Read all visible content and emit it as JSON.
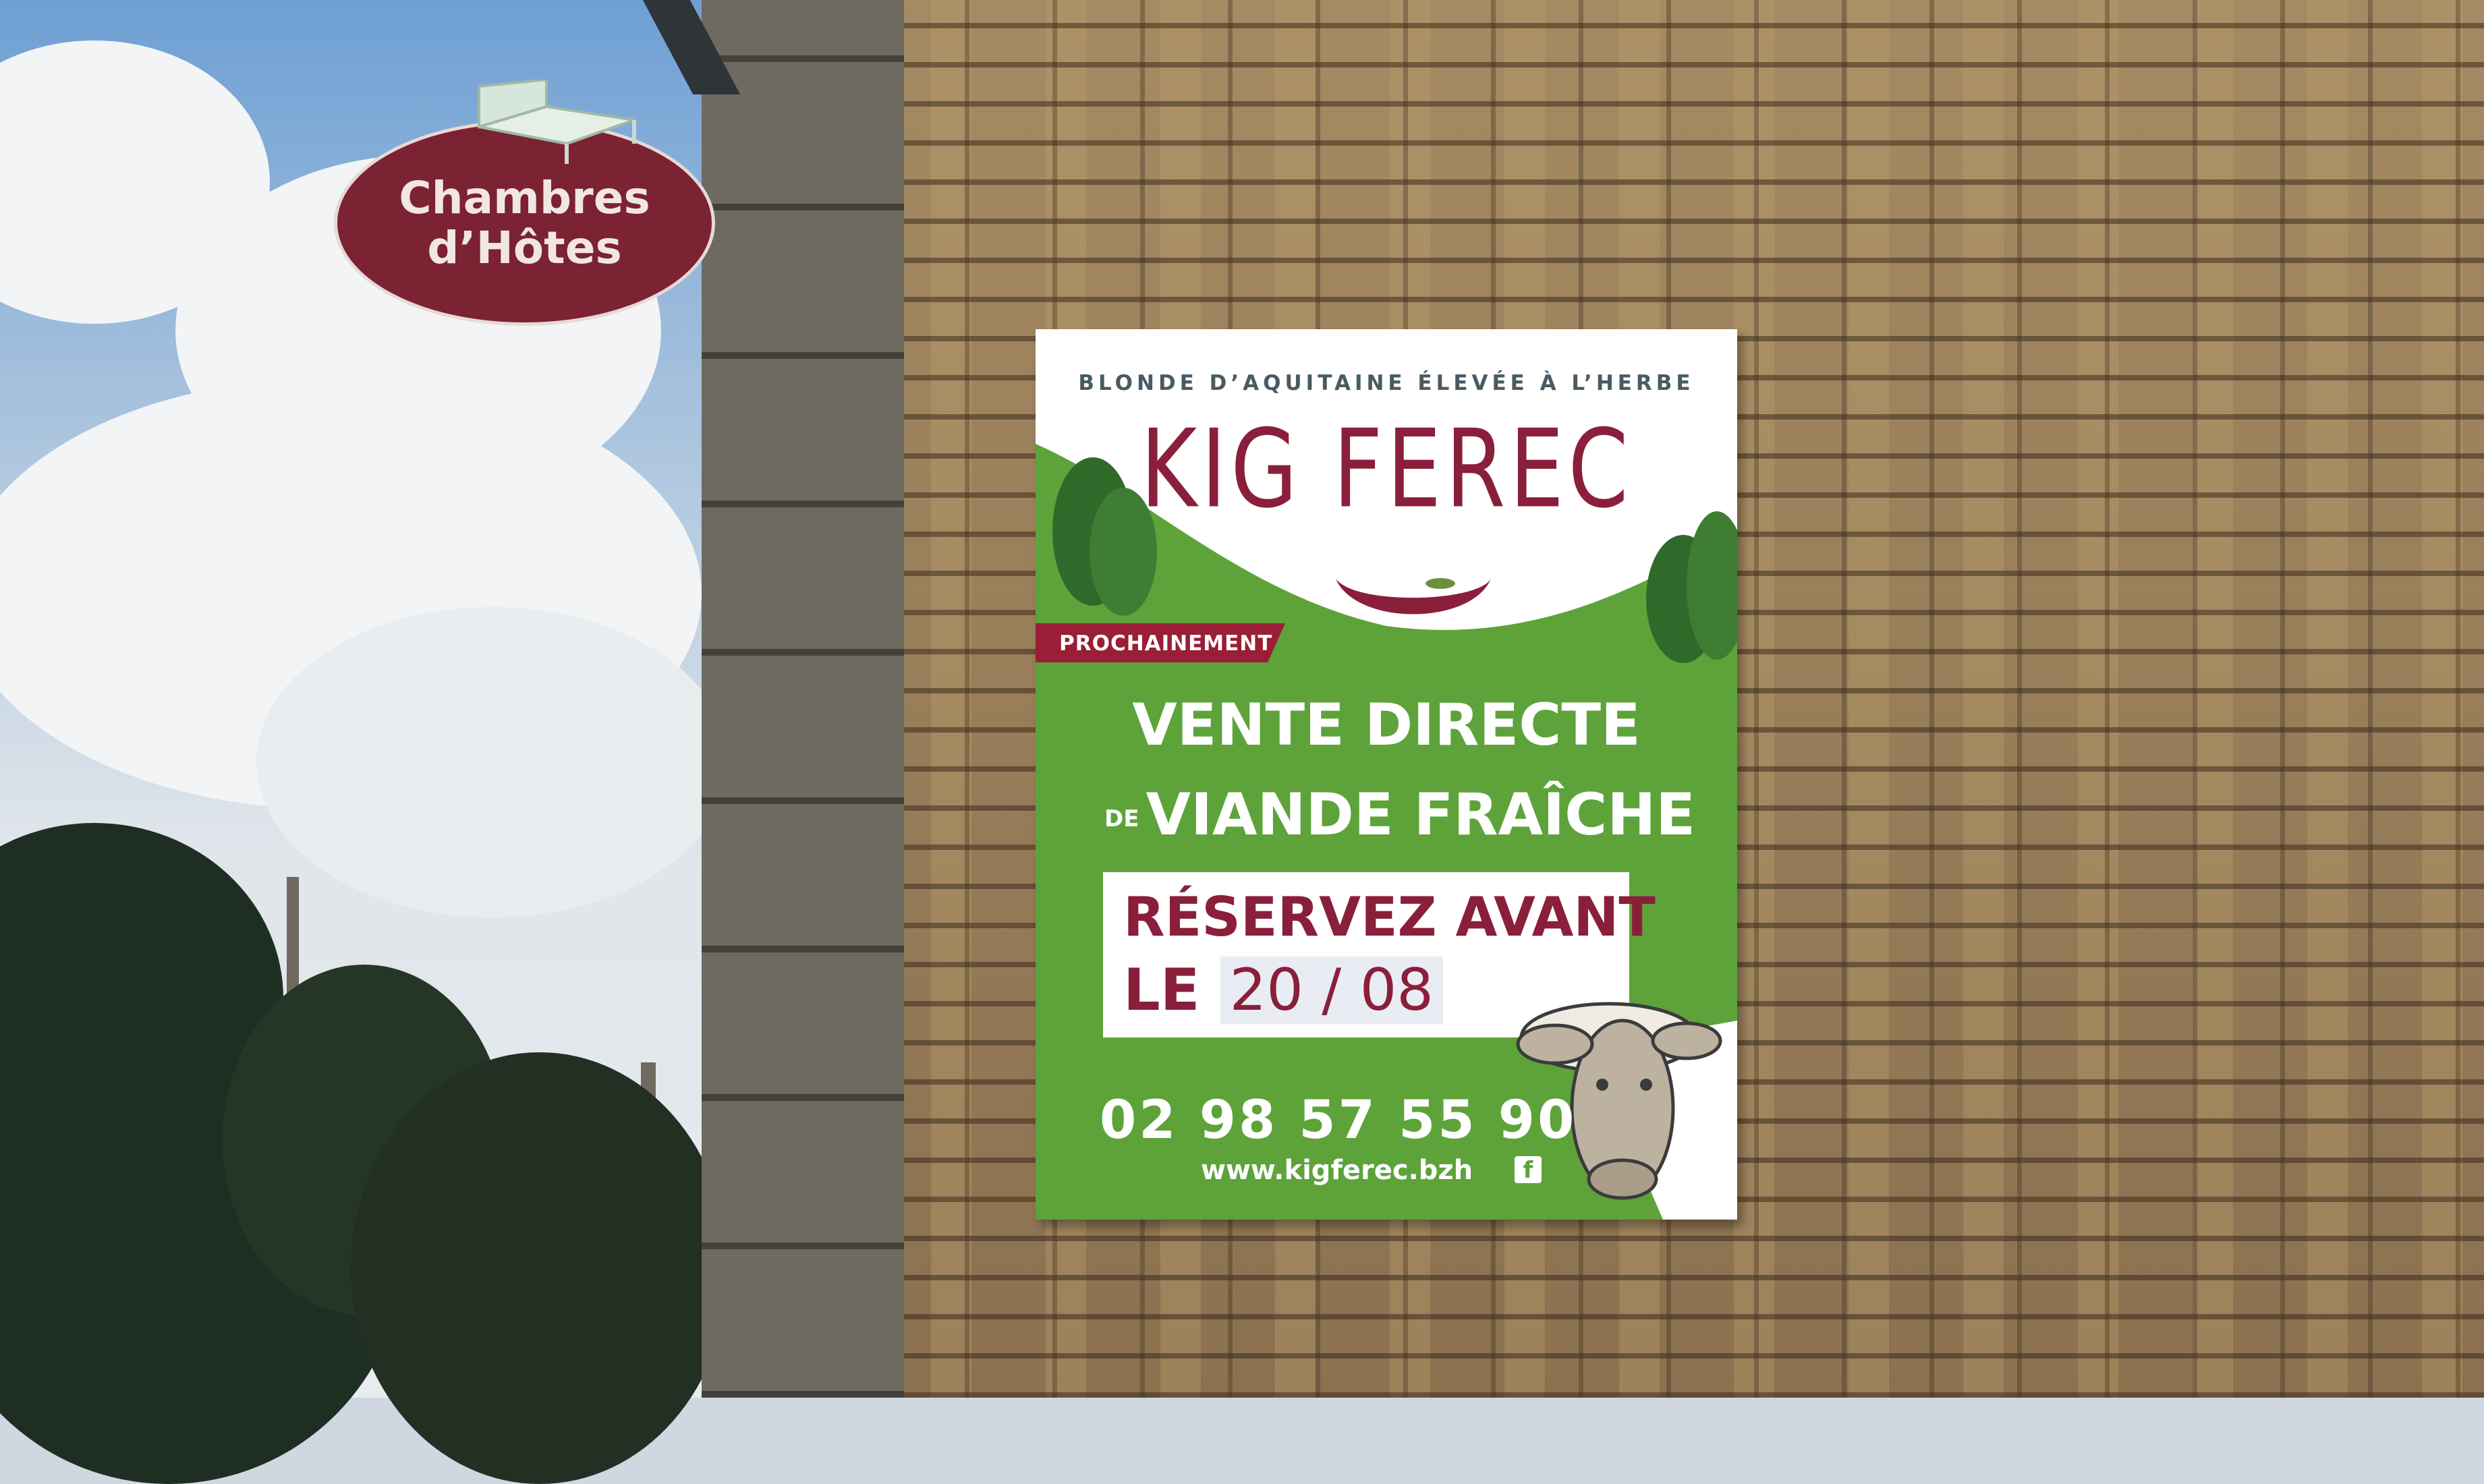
{
  "hanging_sign": {
    "line1": "Chambres",
    "line2": "d’Hôtes",
    "icon": "bed-icon",
    "color": "#7b2233"
  },
  "banner": {
    "tagline": "BLONDE D’AQUITAINE ÉLEVÉE À L’HERBE",
    "brand": "KIG FEREC",
    "ribbon": "PROCHAINEMENT",
    "headline_line1": "VENTE DIRECTE",
    "headline_de": "DE",
    "headline_line2": "VIANDE FRAÎCHE",
    "reserve_line1": "RÉSERVEZ AVANT",
    "reserve_le": "LE",
    "reserve_date": "20 / 08",
    "phone": "02 98 57 55 90",
    "website": "www.kigferec.bzh",
    "facebook_icon": "f",
    "colors": {
      "green": "#5da33a",
      "burgundy": "#8a1f3b",
      "white": "#ffffff"
    }
  }
}
